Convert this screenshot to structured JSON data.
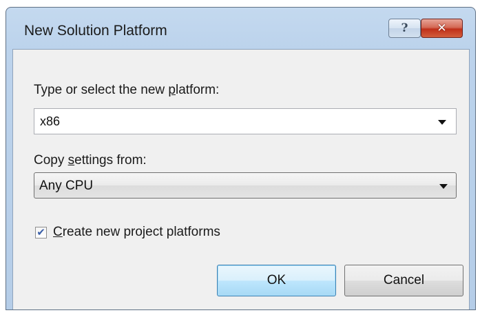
{
  "window": {
    "title": "New Solution Platform",
    "help_glyph": "?",
    "close_glyph": "✕"
  },
  "platform": {
    "label_before": "Type or select the new ",
    "label_mnemonic": "p",
    "label_after": "latform:",
    "value": "x86"
  },
  "copy_settings": {
    "label_before": "Copy ",
    "label_mnemonic": "s",
    "label_after": "ettings from:",
    "value": "Any CPU"
  },
  "create_platforms": {
    "checked": true,
    "label_mnemonic": "C",
    "label_after": "reate new project platforms"
  },
  "buttons": {
    "ok": "OK",
    "cancel": "Cancel"
  }
}
